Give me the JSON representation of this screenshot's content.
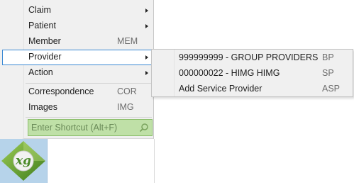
{
  "menu": {
    "items": [
      {
        "label": "Claim",
        "shortcut": ""
      },
      {
        "label": "Patient",
        "shortcut": ""
      },
      {
        "label": "Member",
        "shortcut": "MEM"
      },
      {
        "label": "Provider",
        "shortcut": ""
      },
      {
        "label": "Action",
        "shortcut": ""
      },
      {
        "label": "Correspondence",
        "shortcut": "COR"
      },
      {
        "label": "Images",
        "shortcut": "IMG"
      }
    ],
    "search_placeholder": "Enter Shortcut (Alt+F)"
  },
  "submenu": {
    "items": [
      {
        "label": "999999999 - GROUP PROVIDERS",
        "shortcut": "BP"
      },
      {
        "label": "000000022 - HIMG HIMG",
        "shortcut": "SP"
      },
      {
        "label": "Add Service Provider",
        "shortcut": "ASP"
      }
    ]
  },
  "logo": {
    "text": "xg",
    "color": "#6aa22b"
  },
  "colors": {
    "highlight_border": "#3a88d3",
    "search_bg": "#bfe0a7"
  }
}
